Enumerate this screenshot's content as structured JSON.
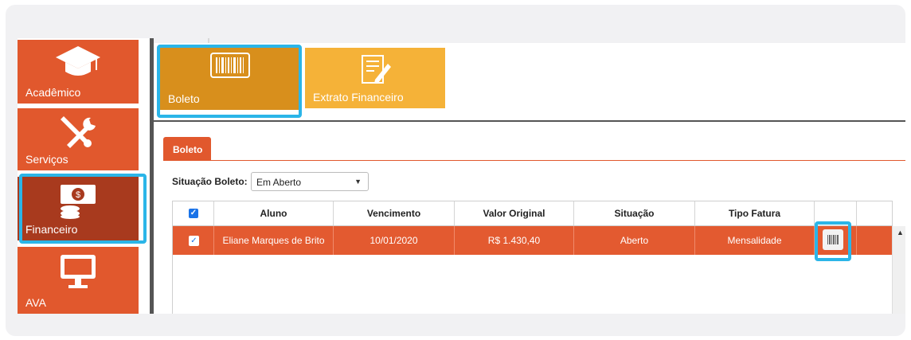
{
  "sidebar": {
    "items": [
      {
        "label": "Acadêmico",
        "icon": "graduation-cap-icon"
      },
      {
        "label": "Serviços",
        "icon": "tools-icon"
      },
      {
        "label": "Financeiro",
        "icon": "money-icon",
        "active": true
      },
      {
        "label": "AVA",
        "icon": "monitor-icon"
      }
    ]
  },
  "toolbar": {
    "boleto_label": "Boleto",
    "extrato_label": "Extrato Financeiro"
  },
  "tab": {
    "label": "Boleto"
  },
  "filter": {
    "label": "Situação Boleto:",
    "value": "Em Aberto"
  },
  "grid": {
    "columns": [
      "Aluno",
      "Vencimento",
      "Valor Original",
      "Situação",
      "Tipo Fatura"
    ],
    "rows": [
      {
        "aluno": "Eliane Marques de Brito",
        "vencimento": "10/01/2020",
        "valor": "R$ 1.430,40",
        "situacao": "Aberto",
        "tipo": "Mensalidade"
      }
    ]
  },
  "colors": {
    "accent": "#e1582d",
    "active": "#a83a1e",
    "highlight": "#2bb5e8",
    "boleto_tile": "#d88f1c",
    "extrato_tile": "#f5b238"
  }
}
